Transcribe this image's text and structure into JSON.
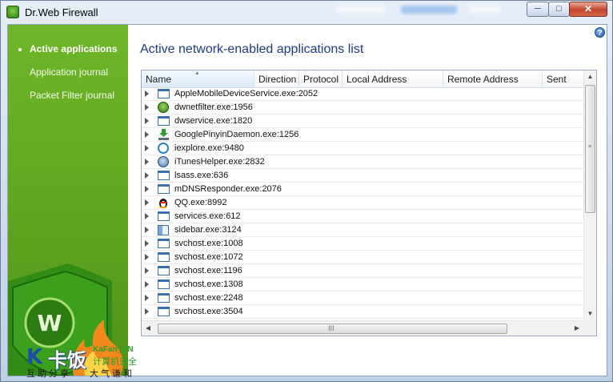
{
  "window": {
    "title": "Dr.Web Firewall",
    "buttons": {
      "minimize": "─",
      "maximize": "□",
      "close": "✕"
    }
  },
  "sidebar": {
    "items": [
      {
        "label": "Active applications",
        "active": true
      },
      {
        "label": "Application journal",
        "active": false
      },
      {
        "label": "Packet Filter journal",
        "active": false
      }
    ]
  },
  "main": {
    "title": "Active network-enabled applications list",
    "help": "?"
  },
  "table": {
    "sort_indicator": "▲",
    "columns": [
      "Name",
      "Direction",
      "Protocol",
      "Local Address",
      "Remote Address",
      "Sent"
    ],
    "rows": [
      {
        "name": "AppleMobileDeviceService.exe:2052",
        "icon": "window-icon"
      },
      {
        "name": "dwnetfilter.exe:1956",
        "icon": "drweb-spider-icon"
      },
      {
        "name": "dwservice.exe:1820",
        "icon": "window-icon"
      },
      {
        "name": "GooglePinyinDaemon.exe:1256",
        "icon": "download-arrow-icon"
      },
      {
        "name": "iexplore.exe:9480",
        "icon": "internet-explorer-icon"
      },
      {
        "name": "iTunesHelper.exe:2832",
        "icon": "itunes-icon"
      },
      {
        "name": "lsass.exe:636",
        "icon": "window-icon"
      },
      {
        "name": "mDNSResponder.exe:2076",
        "icon": "window-icon"
      },
      {
        "name": "QQ.exe:8992",
        "icon": "qq-penguin-icon"
      },
      {
        "name": "services.exe:612",
        "icon": "window-icon"
      },
      {
        "name": "sidebar.exe:3124",
        "icon": "sidebar-icon"
      },
      {
        "name": "svchost.exe:1008",
        "icon": "window-icon"
      },
      {
        "name": "svchost.exe:1072",
        "icon": "window-icon"
      },
      {
        "name": "svchost.exe:1196",
        "icon": "window-icon"
      },
      {
        "name": "svchost.exe:1308",
        "icon": "window-icon"
      },
      {
        "name": "svchost.exe:2248",
        "icon": "window-icon"
      },
      {
        "name": "svchost.exe:3504",
        "icon": "window-icon"
      }
    ],
    "scroll": {
      "up": "▲",
      "down": "▼",
      "left": "◀",
      "right": "▶",
      "vgrip": "≡",
      "hgrip": "III"
    }
  },
  "watermark": {
    "logo_letter": "K",
    "logo_cn": "卡饭",
    "brand": "KaFan_CN",
    "brand_sub": "计算机安全",
    "slogan_left": "互助分享",
    "slogan_right": "大气谦和"
  },
  "colors": {
    "sidebar_green": "#5ea31f",
    "title_blue": "#1f3a8a",
    "close_red": "#c4452c"
  }
}
